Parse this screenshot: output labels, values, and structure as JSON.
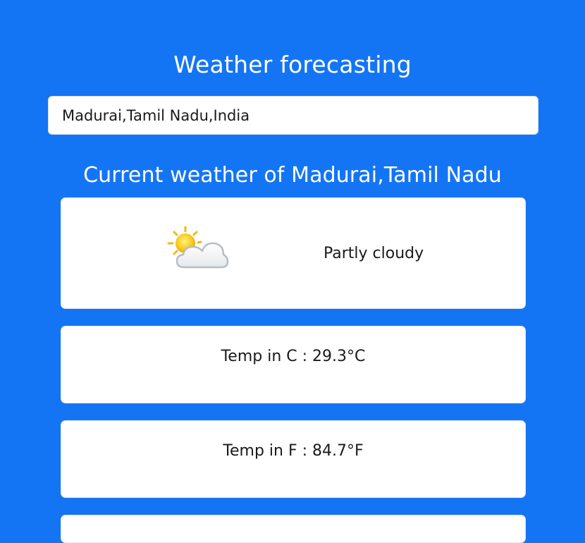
{
  "header": {
    "title": "Weather forecasting"
  },
  "search": {
    "value": "Madurai,Tamil Nadu,India"
  },
  "current": {
    "heading": "Current weather of Madurai,Tamil Nadu",
    "condition": "Partly cloudy",
    "condition_icon": "partly-cloudy-icon",
    "temp_c": "Temp in C : 29.3°C",
    "temp_f": "Temp in F : 84.7°F"
  },
  "colors": {
    "background": "#1475f4",
    "card": "#ffffff",
    "text": "#1a1a1a"
  }
}
